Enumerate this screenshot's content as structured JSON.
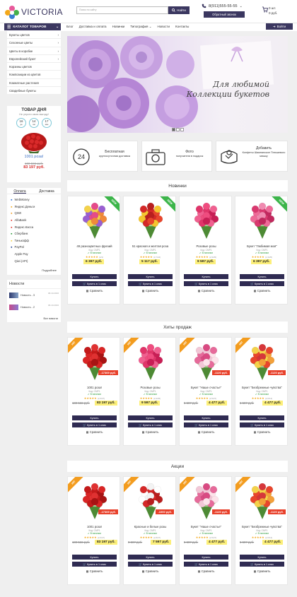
{
  "header": {
    "logo": "VICTORIA",
    "search_placeholder": "Поиск по сайту",
    "search_button": "Найти",
    "phone": "8(911)555-55-55",
    "callback": "Обратный звонок",
    "cart_count": "0 шт.",
    "cart_sum": "0 руб."
  },
  "nav": {
    "catalog": "КАТАЛОГ ТОВАРОВ",
    "links": [
      "Блог",
      "Доставка и оплата",
      "Новинки",
      "Типография",
      "Новости",
      "Контакты"
    ],
    "login": "Войти"
  },
  "sidebar_menu": [
    "Букеты цветов",
    "Сезонные цветы",
    "Цветы в коробке",
    "Европейский букет",
    "Корзины цветов",
    "Композиции из цветов",
    "Комнатные растения",
    "Свадебные букеты"
  ],
  "deal": {
    "title": "ТОВАР ДНЯ",
    "subtitle": "Не упусти свою выгоду!",
    "timer": [
      {
        "v": "16",
        "u": "дн"
      },
      {
        "v": "14",
        "u": "час"
      },
      {
        "v": "17",
        "u": "мин"
      }
    ],
    "name": "1001 роза!",
    "old_price": "100 566 руб.",
    "price": "83 197 руб."
  },
  "payment": {
    "tabs": [
      "Оплата",
      "Доставка"
    ],
    "items": [
      "WebMoney",
      "Яндекс.Деньги",
      "QIWI",
      "AlfaBank",
      "Яндекс.Касса",
      "Сбербанк",
      "Тинькофф",
      "PayPal",
      "Apple Pay",
      "Qiwi (API)"
    ],
    "more": "Подробнее"
  },
  "news": {
    "title": "Новости",
    "items": [
      {
        "title": "Новость - 3",
        "date": "06.10.2016"
      },
      {
        "title": "Новость - 2",
        "date": "06.10.2016"
      }
    ],
    "all": "Все новости"
  },
  "banner": {
    "line1": "Для любимой",
    "line2": "Коллекции букетов"
  },
  "features": [
    {
      "text1": "Бесплатная",
      "text2": "круглосуточная доставка",
      "icon": "clock-24-icon"
    },
    {
      "text1": "Фото",
      "text2": "получателя в подарок",
      "icon": "camera-icon"
    },
    {
      "text1": "Добавить",
      "text2": "Конфеты Шампанское Плюшевого мишку",
      "icon": "gift-box-icon"
    }
  ],
  "card_labels": {
    "buy": "Купить",
    "buy_one": "Купить в 1 клик",
    "compare": "Сравнить",
    "code": "Код: CMP1",
    "avail": "В наличии"
  },
  "sections": [
    {
      "title": "Новинки",
      "products": [
        {
          "name": "49 разноцветных фрезий",
          "price": "6 397 руб.",
          "old": "",
          "discount": "",
          "ribbon": "NEW",
          "ribbon_color": "#3cb54a",
          "votes": "(4/1)",
          "palette": [
            "#f4d24a",
            "#9a5fd1",
            "#f08a3a",
            "#e54b8a"
          ]
        },
        {
          "name": "51 красная и желтая роза",
          "price": "5 117 руб.",
          "old": "",
          "discount": "",
          "ribbon": "NEW",
          "ribbon_color": "#3cb54a",
          "votes": "(3,7/24)",
          "palette": [
            "#d42828",
            "#f4c530",
            "#e8452c",
            "#b81e1e"
          ]
        },
        {
          "name": "Розовые розы",
          "price": "9 597 руб.",
          "old": "",
          "discount": "",
          "ribbon": "",
          "ribbon_color": "",
          "votes": "(2,9/25)",
          "palette": [
            "#e0356a",
            "#f06090",
            "#c81e55",
            "#ef4c7f"
          ]
        },
        {
          "name": "Букет \"Любимая моя\"",
          "price": "6 397 руб.",
          "old": "",
          "discount": "",
          "ribbon": "NEW",
          "ribbon_color": "#3cb54a",
          "votes": "(1,9/25)",
          "palette": [
            "#d9386f",
            "#ee6a98",
            "#c1285e",
            "#f08ab0"
          ]
        }
      ]
    },
    {
      "title": "Хиты продаж",
      "products": [
        {
          "name": "1001 роза!",
          "price": "83 197 руб.",
          "old": "100 566 руб.",
          "discount": "-17369 руб.",
          "ribbon": "HIT",
          "ribbon_color": "#f39c1e",
          "votes": "(2,6/27)",
          "palette": [
            "#c41a1a",
            "#d92525",
            "#a81313",
            "#e03131"
          ]
        },
        {
          "name": "Розовые розы",
          "price": "9 597 руб.",
          "old": "",
          "discount": "",
          "ribbon": "HIT",
          "ribbon_color": "#f39c1e",
          "votes": "(2,9/25)",
          "palette": [
            "#e0356a",
            "#f06090",
            "#c81e55",
            "#ef4c7f"
          ]
        },
        {
          "name": "Букет \"Наше счастье\"",
          "price": "4 477 руб.",
          "old": "5 597 руб.",
          "discount": "-1120 руб.",
          "ribbon": "HIT",
          "ribbon_color": "#f39c1e",
          "votes": "(2,5/27)",
          "palette": [
            "#f2c7d6",
            "#e66a9a",
            "#fde3ea",
            "#d94a82"
          ]
        },
        {
          "name": "Букет \"Безбрежные чувства\"",
          "price": "4 477 руб.",
          "old": "5 597 руб.",
          "discount": "-1120 руб.",
          "ribbon": "HIT",
          "ribbon_color": "#f39c1e",
          "votes": "(2,6/14)",
          "palette": [
            "#f4d24a",
            "#e8452c",
            "#f3a03a",
            "#d6363a"
          ]
        }
      ]
    },
    {
      "title": "Акции",
      "products": [
        {
          "name": "1001 роза!",
          "price": "83 197 руб.",
          "old": "100 566 руб.",
          "discount": "-17369 руб.",
          "ribbon": "HIT",
          "ribbon_color": "#f39c1e",
          "votes": "(2,6/27)",
          "palette": [
            "#c41a1a",
            "#d92525",
            "#a81313",
            "#e03131"
          ]
        },
        {
          "name": "Красные и белые розы",
          "price": "7 597 руб.",
          "old": "8 597 руб.",
          "discount": "-1000 руб.",
          "ribbon": "HIT",
          "ribbon_color": "#f39c1e",
          "votes": "(2,8/27)",
          "palette": [
            "#d42828",
            "#ffffff",
            "#b81e1e",
            "#f3f3f3"
          ]
        },
        {
          "name": "Букет \"Наше счастье\"",
          "price": "4 477 руб.",
          "old": "5 597 руб.",
          "discount": "-1120 руб.",
          "ribbon": "HIT",
          "ribbon_color": "#f39c1e",
          "votes": "(2,5/27)",
          "palette": [
            "#f2c7d6",
            "#e66a9a",
            "#fde3ea",
            "#d94a82"
          ]
        },
        {
          "name": "Букет \"Безбрежные чувства\"",
          "price": "4 477 руб.",
          "old": "5 597 руб.",
          "discount": "-1120 руб.",
          "ribbon": "HIT",
          "ribbon_color": "#f39c1e",
          "votes": "(2,6/14)",
          "palette": [
            "#f4d24a",
            "#e8452c",
            "#f3a03a",
            "#d6363a"
          ]
        }
      ]
    }
  ]
}
